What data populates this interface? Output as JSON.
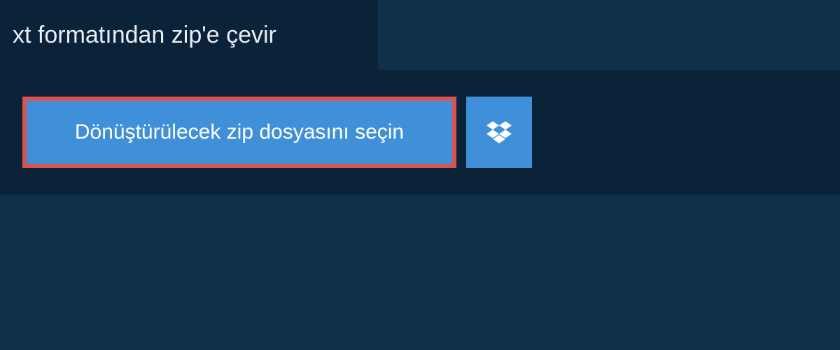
{
  "header": {
    "title": "xt formatından zip'e çevir"
  },
  "actions": {
    "select_file_label": "Dönüştürülecek zip dosyasını seçin",
    "dropbox_icon_name": "dropbox"
  },
  "colors": {
    "background": "#0f2f4b",
    "panel": "#0a2339",
    "button": "#4090d9",
    "highlight_border": "#d9544f",
    "text_light": "#e8eef4",
    "text_white": "#ffffff"
  }
}
